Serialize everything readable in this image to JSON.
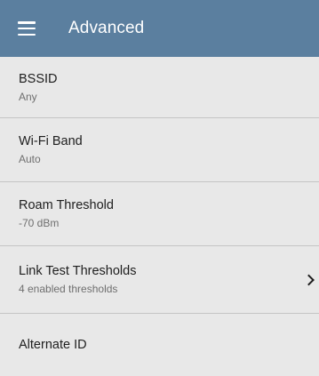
{
  "header": {
    "title": "Advanced",
    "menu_icon": "hamburger-menu-icon",
    "bar_color": "#5b7f9f"
  },
  "settings": [
    {
      "title": "BSSID",
      "subtitle": "Any",
      "has_chevron": false
    },
    {
      "title": "Wi-Fi Band",
      "subtitle": "Auto",
      "has_chevron": false
    },
    {
      "title": "Roam Threshold",
      "subtitle": "-70 dBm",
      "has_chevron": false
    },
    {
      "title": "Link Test Thresholds",
      "subtitle": "4 enabled thresholds",
      "has_chevron": true,
      "chevron_icon": "chevron-right-icon"
    },
    {
      "title": "Alternate ID",
      "subtitle": "",
      "has_chevron": false
    }
  ]
}
